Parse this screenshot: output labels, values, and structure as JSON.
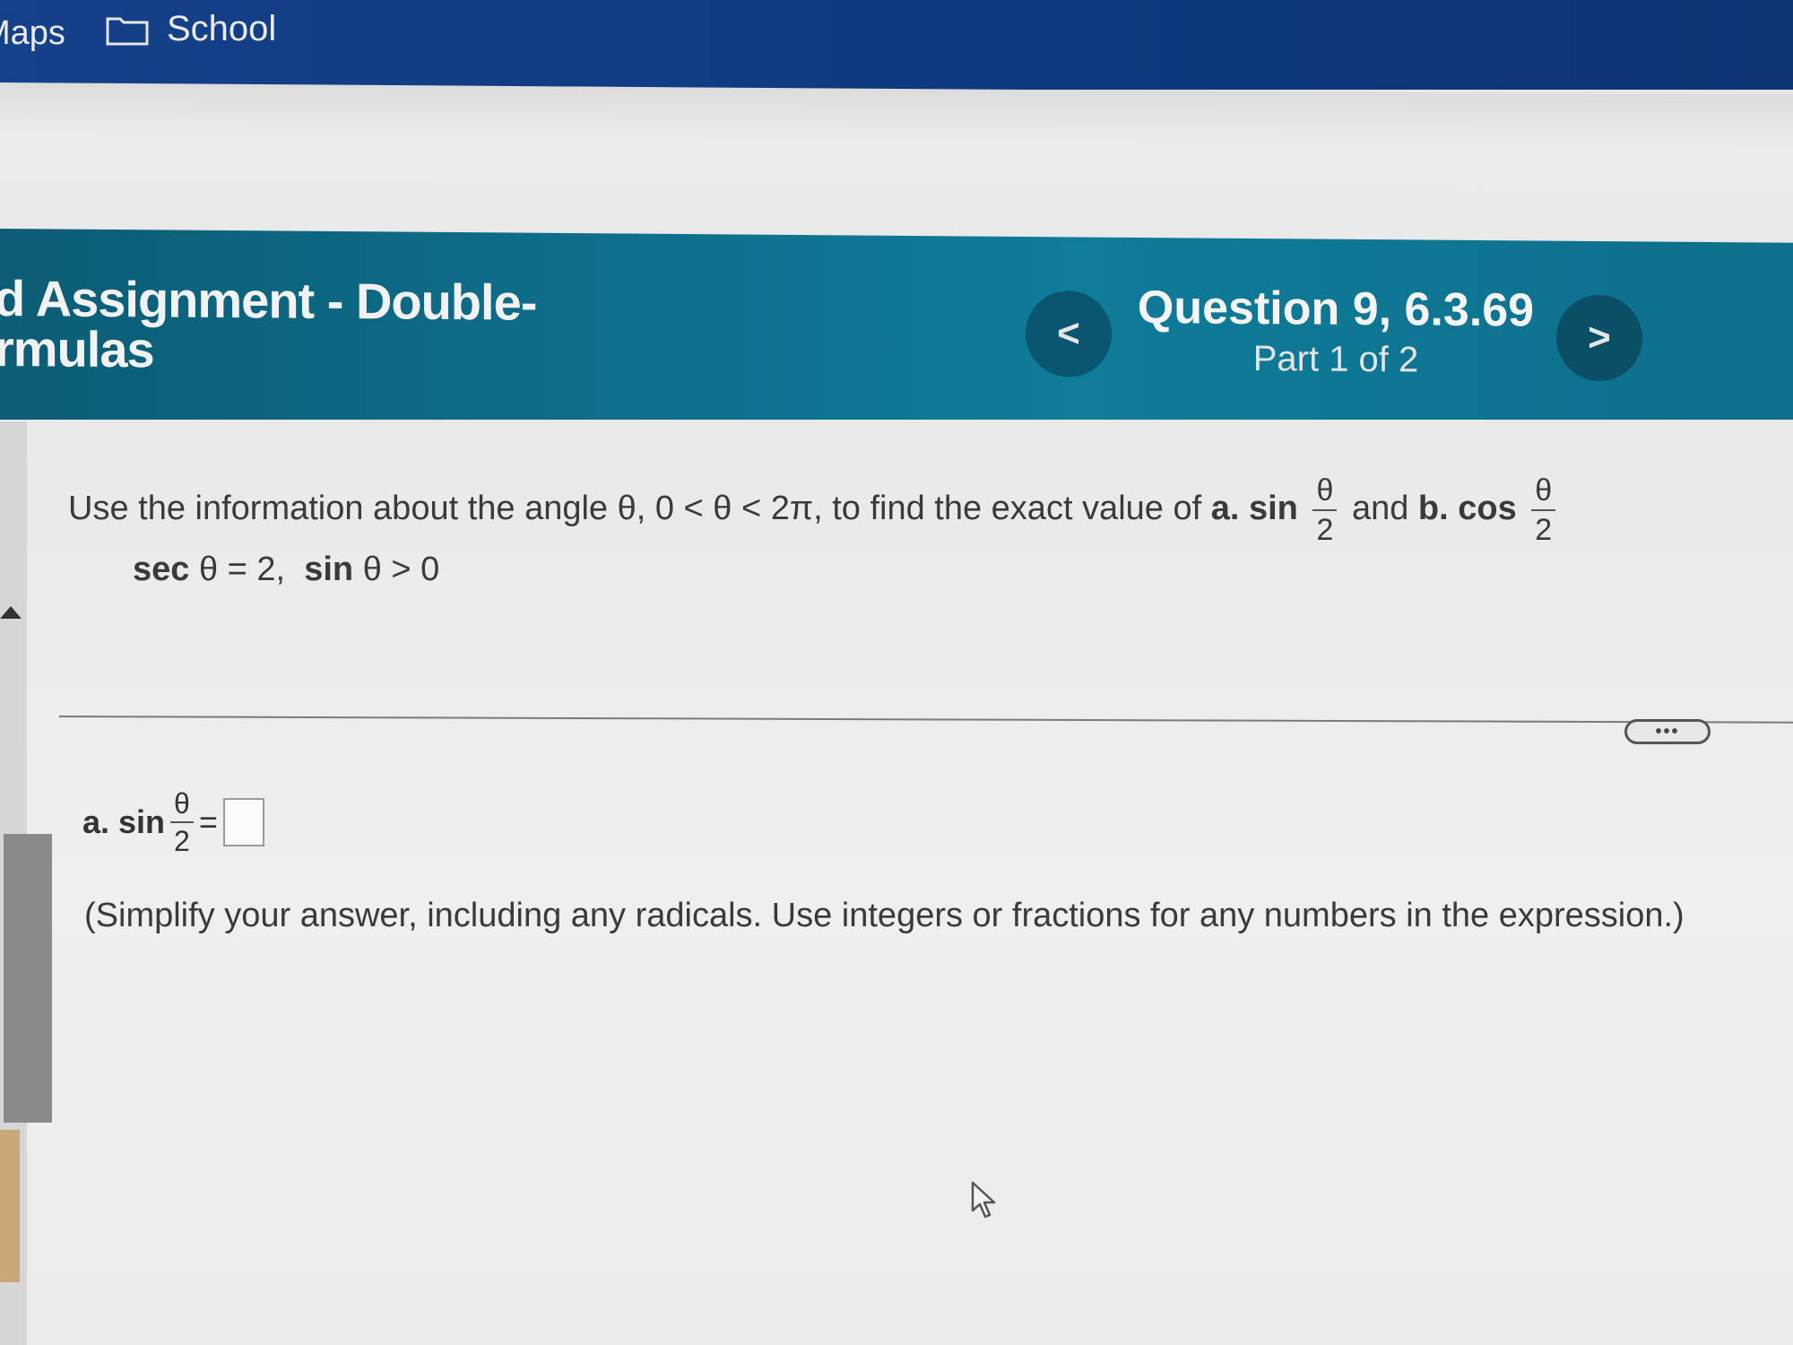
{
  "bookmarks": {
    "maps_label": "Maps",
    "school_label": "School"
  },
  "header": {
    "assignment_title_line1": "d Assignment - Double-",
    "assignment_title_line2": "rmulas",
    "question_title": "Question 9, 6.3.69",
    "question_part": "Part 1 of 2",
    "prev_icon": "<",
    "next_icon": ">"
  },
  "problem": {
    "prompt_text": "Use the information about the angle θ, 0 < θ < 2π, to find the exact value of",
    "part_a_label": "a.",
    "sin_label": "sin",
    "frac_num": "θ",
    "frac_den": "2",
    "and_text": "and",
    "part_b_label": "b.",
    "cos_label": "cos",
    "given_sec": "sec",
    "given_value": "θ = 2,",
    "given_sin": "sin",
    "given_condition": "θ > 0"
  },
  "more_button": "•••",
  "answer": {
    "label": "a. sin",
    "equals": "=",
    "hint": "(Simplify your answer, including any radicals. Use integers or fractions for any numbers in the expression.)"
  },
  "colors": {
    "bookmarks_bg": "#15418a",
    "header_bg": "#0e6f8c",
    "nav_button_bg": "#0a5570"
  }
}
